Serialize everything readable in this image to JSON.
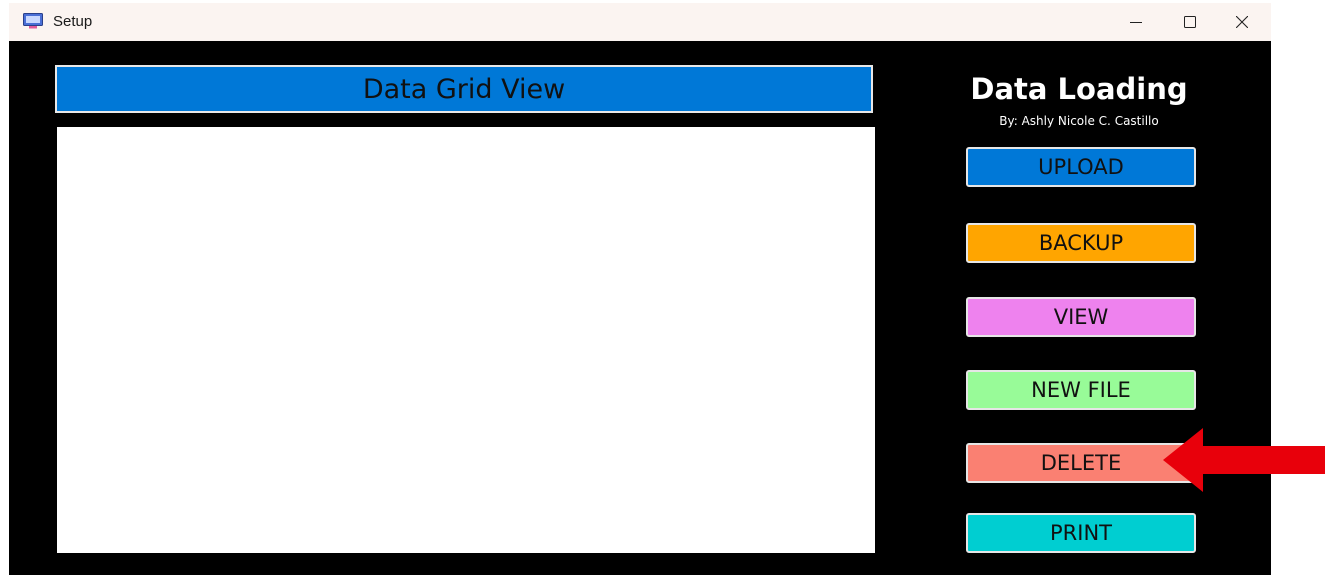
{
  "window": {
    "title": "Setup",
    "app_icon": "setup-app-icon",
    "controls": {
      "minimize_icon": "minimize-icon",
      "maximize_icon": "maximize-icon",
      "close_icon": "close-icon"
    }
  },
  "grid": {
    "header_label": "Data Grid View",
    "header_color": "#0078d7"
  },
  "panel": {
    "title": "Data Loading",
    "author": "By: Ashly Nicole C. Castillo"
  },
  "buttons": [
    {
      "label": "UPLOAD",
      "color": "#0078d7"
    },
    {
      "label": "BACKUP",
      "color": "#ffa500"
    },
    {
      "label": "VIEW",
      "color": "#ee82ee"
    },
    {
      "label": "NEW FILE",
      "color": "#98fb98"
    },
    {
      "label": "DELETE",
      "color": "#fa8072"
    },
    {
      "label": "PRINT",
      "color": "#00ced1"
    }
  ],
  "annotation": {
    "arrow_icon": "red-arrow-icon",
    "arrow_color": "#e8000b",
    "points_to": "DELETE"
  }
}
